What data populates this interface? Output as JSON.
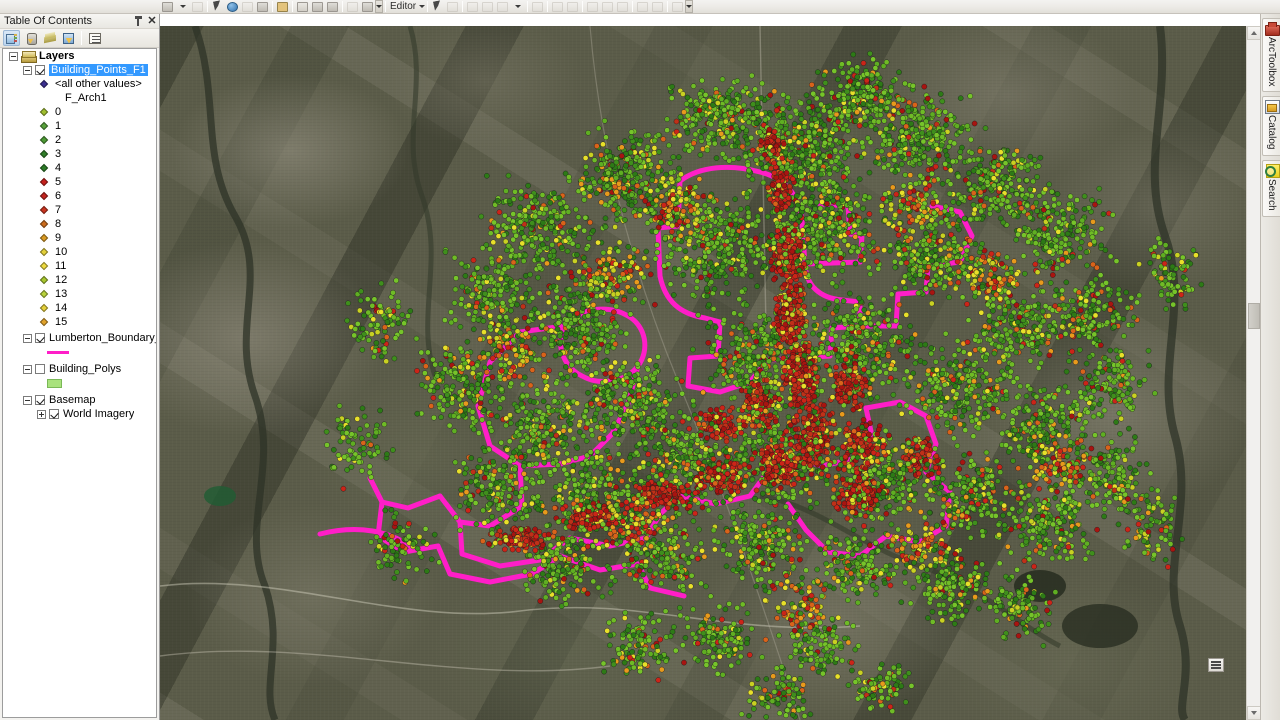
{
  "toolbar": {
    "editor_label": "Editor",
    "tools": [
      {
        "name": "pan-tool",
        "icon": "pan-icon"
      },
      {
        "name": "select-features-tool",
        "icon": "select-icon"
      },
      {
        "name": "identify-tool",
        "icon": "identify-icon"
      },
      {
        "name": "hyperlink-tool",
        "icon": "hyperlink-icon"
      },
      {
        "name": "html-popup-tool",
        "icon": "html-popup-icon"
      },
      {
        "name": "measure-tool",
        "icon": "ruler-icon"
      },
      {
        "name": "find-tool",
        "icon": "binoculars-icon"
      },
      {
        "name": "find-route-tool",
        "icon": "route-icon"
      },
      {
        "name": "go-to-xy-tool",
        "icon": "xy-icon"
      },
      {
        "name": "time-slider-tool",
        "icon": "clock-icon"
      },
      {
        "name": "create-viewer-window-tool",
        "icon": "viewer-icon"
      }
    ],
    "editor_tools": [
      {
        "name": "edit-tool",
        "icon": "arrow-icon"
      },
      {
        "name": "edit-annotation-tool",
        "icon": "annotation-icon"
      },
      {
        "name": "straight-segment-tool",
        "icon": "line-icon"
      },
      {
        "name": "trace-tool",
        "icon": "trace-icon"
      },
      {
        "name": "endpoint-arc-tool",
        "icon": "arc-icon"
      },
      {
        "name": "sketch-properties-tool",
        "icon": "sketch-icon"
      },
      {
        "name": "construct-polygon-tool",
        "icon": "polygon-icon"
      },
      {
        "name": "split-tool",
        "icon": "split-icon"
      },
      {
        "name": "merge-tool",
        "icon": "merge-icon"
      },
      {
        "name": "rotate-tool",
        "icon": "rotate-icon"
      },
      {
        "name": "attributes-tool",
        "icon": "attributes-icon"
      },
      {
        "name": "table-tool",
        "icon": "table-icon"
      },
      {
        "name": "sketch-tool",
        "icon": "sketch2-icon"
      },
      {
        "name": "editor-windows-tool",
        "icon": "windows-icon"
      }
    ]
  },
  "toc": {
    "title": "Table Of Contents",
    "toolbar_buttons": [
      {
        "name": "list-by-drawing-order",
        "icon": "drawing-order-icon",
        "active": true
      },
      {
        "name": "list-by-source",
        "icon": "source-icon",
        "active": false
      },
      {
        "name": "list-by-visibility",
        "icon": "visibility-icon",
        "active": false
      },
      {
        "name": "list-by-selection",
        "icon": "selection-icon",
        "active": false
      },
      {
        "name": "toc-options",
        "icon": "options-icon",
        "active": false
      }
    ],
    "root": "Layers",
    "layers": [
      {
        "name": "Building_Points_F1",
        "checked": true,
        "selected": true,
        "field_heading": "F_Arch1",
        "all_other_values": "<all other values>",
        "all_other_color": "#3b2f8f",
        "classes": [
          {
            "label": "0",
            "color": "#9fbe2e"
          },
          {
            "label": "1",
            "color": "#57a03a"
          },
          {
            "label": "2",
            "color": "#4d9a34"
          },
          {
            "label": "3",
            "color": "#2f7d28"
          },
          {
            "label": "4",
            "color": "#2b7a26"
          },
          {
            "label": "5",
            "color": "#c4201c"
          },
          {
            "label": "6",
            "color": "#c0231e"
          },
          {
            "label": "7",
            "color": "#c8331f"
          },
          {
            "label": "8",
            "color": "#c96a1c"
          },
          {
            "label": "9",
            "color": "#d99a22"
          },
          {
            "label": "10",
            "color": "#e2cf3a"
          },
          {
            "label": "11",
            "color": "#ecd93f"
          },
          {
            "label": "12",
            "color": "#a8c72f"
          },
          {
            "label": "13",
            "color": "#b7d13a"
          },
          {
            "label": "14",
            "color": "#e4cf3a"
          },
          {
            "label": "15",
            "color": "#e0a22a"
          }
        ]
      },
      {
        "name": "Lumberton_Boundary_Or",
        "checked": true,
        "symbol_type": "line",
        "symbol_color": "#ff1ec8"
      },
      {
        "name": "Building_Polys",
        "checked": false,
        "symbol_type": "polygon",
        "symbol_fill": "#a9e27d",
        "symbol_outline": "#7ab857"
      },
      {
        "name": "Basemap",
        "checked": true,
        "children": [
          {
            "name": "World Imagery",
            "checked": true
          }
        ]
      }
    ]
  },
  "dock": {
    "tabs": [
      {
        "label": "ArcToolbox",
        "icon": "arctoolbox-icon"
      },
      {
        "label": "Catalog",
        "icon": "catalog-icon"
      },
      {
        "label": "Search",
        "icon": "search-icon"
      }
    ]
  },
  "map": {
    "basemap": "World Imagery",
    "boundary_color": "#ff1ec8",
    "point_palette": [
      "#76c42a",
      "#5fae22",
      "#3f8f1c",
      "#2d7a16",
      "#c9d122",
      "#e8e02a",
      "#e89a1c",
      "#d9631a",
      "#cc2418",
      "#a81410"
    ],
    "background_color": "#5b5c49"
  }
}
